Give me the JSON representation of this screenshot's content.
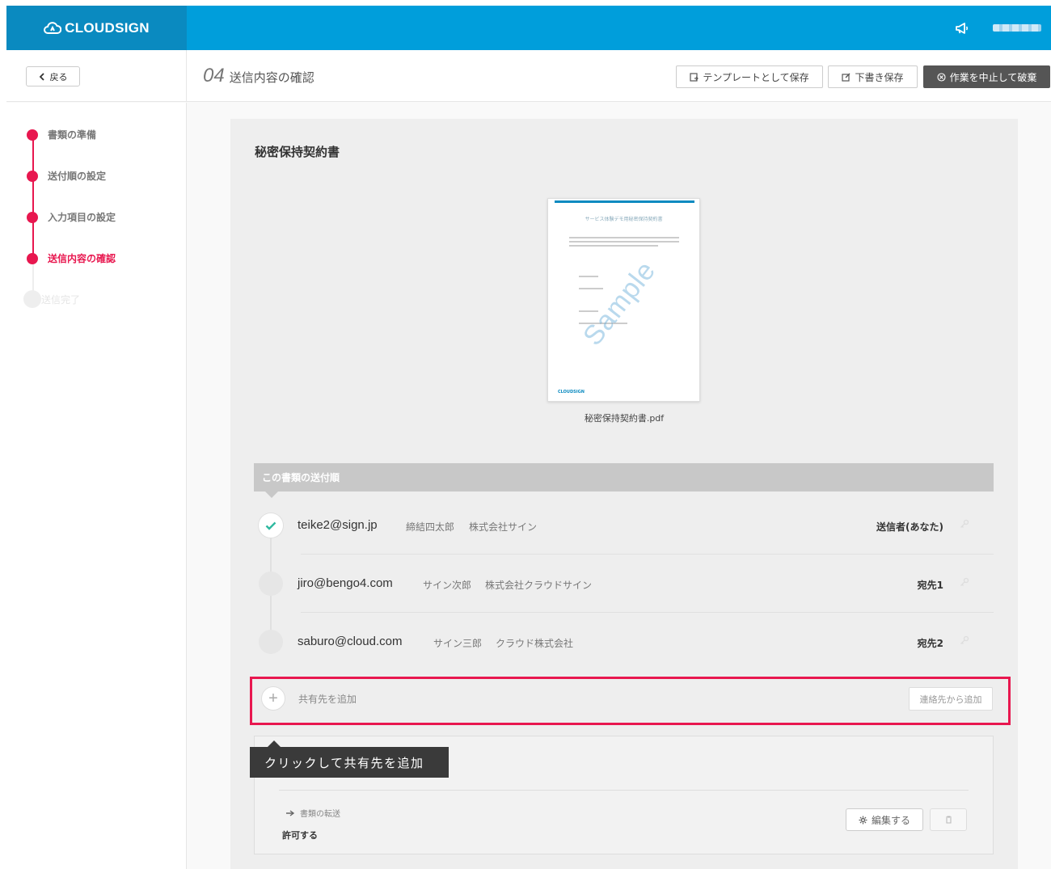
{
  "app": {
    "logo_text": "CLOUDSIGN",
    "accent_color": "#009edb",
    "highlight_color": "#e8174f"
  },
  "header": {
    "back_label": "戻る",
    "step_number": "04",
    "step_name": "送信内容の確認",
    "save_template_label": "テンプレートとして保存",
    "save_draft_label": "下書き保存",
    "discard_label": "作業を中止して破棄"
  },
  "sidebar": {
    "steps": [
      {
        "label": "書類の準備",
        "state": "done"
      },
      {
        "label": "送付順の設定",
        "state": "done"
      },
      {
        "label": "入力項目の設定",
        "state": "done"
      },
      {
        "label": "送信内容の確認",
        "state": "current"
      },
      {
        "label": "送信完了",
        "state": "todo"
      }
    ]
  },
  "document": {
    "title": "秘密保持契約書",
    "file_name": "秘密保持契約書.pdf",
    "preview_heading": "サービス体験デモ用秘密保持契約書",
    "preview_watermark": "Sample",
    "preview_footer": "CLOUDSIGN"
  },
  "routing": {
    "header": "この書類の送付順",
    "recipients": [
      {
        "email": "teike2@sign.jp",
        "name": "締結四太郎",
        "company": "株式会社サイン",
        "role": "送信者(あなた)",
        "status": "done"
      },
      {
        "email": "jiro@bengo4.com",
        "name": "サイン次郎",
        "company": "株式会社クラウドサイン",
        "role": "宛先1",
        "status": "pending"
      },
      {
        "email": "saburo@cloud.com",
        "name": "サイン三郎",
        "company": "クラウド株式会社",
        "role": "宛先2",
        "status": "pending"
      }
    ]
  },
  "share": {
    "add_label": "共有先を追加",
    "add_from_contacts_label": "連絡先から追加",
    "tooltip": "クリックして共有先を追加"
  },
  "settings": {
    "transfer_label": "書類の転送",
    "transfer_value": "許可する",
    "edit_label": "編集する"
  }
}
